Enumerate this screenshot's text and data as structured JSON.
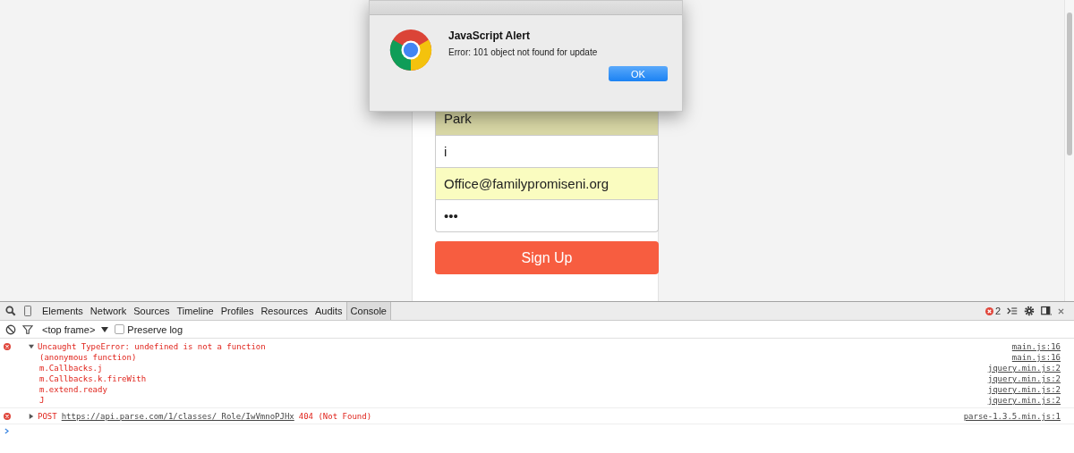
{
  "page": {
    "fields": [
      {
        "value": "Park",
        "autofilled": true
      },
      {
        "value": "i",
        "autofilled": false
      },
      {
        "value": "Office@familypromiseni.org",
        "autofilled": true
      },
      {
        "value": "•••",
        "autofilled": false
      }
    ],
    "button": "Sign Up"
  },
  "alert": {
    "title": "JavaScript Alert",
    "message": "Error: 101 object not found for update",
    "button": "OK"
  },
  "devtools": {
    "tabs": [
      {
        "label": "Elements",
        "selected": false
      },
      {
        "label": "Network",
        "selected": false
      },
      {
        "label": "Sources",
        "selected": false
      },
      {
        "label": "Timeline",
        "selected": false
      },
      {
        "label": "Profiles",
        "selected": false
      },
      {
        "label": "Resources",
        "selected": false
      },
      {
        "label": "Audits",
        "selected": false
      },
      {
        "label": "Console",
        "selected": true
      }
    ],
    "error_count": "2",
    "frame": "<top frame>",
    "preserve_log": {
      "label": "Preserve log",
      "checked": false
    },
    "messages": [
      {
        "expanded": true,
        "text": "Uncaught TypeError: undefined is not a function",
        "source": "main.js:16",
        "stack": [
          {
            "text": "(anonymous function)",
            "source": "main.js:16"
          },
          {
            "text": "m.Callbacks.j",
            "source": "jquery.min.js:2"
          },
          {
            "text": "m.Callbacks.k.fireWith",
            "source": "jquery.min.js:2"
          },
          {
            "text": "m.extend.ready",
            "source": "jquery.min.js:2"
          },
          {
            "text": "J",
            "source": "jquery.min.js:2"
          }
        ]
      },
      {
        "expanded": false,
        "method": "POST",
        "url": "https://api.parse.com/1/classes/_Role/IwVmnoPJHx",
        "text": "404 (Not Found)",
        "source": "parse-1.3.5.min.js:1"
      }
    ]
  }
}
